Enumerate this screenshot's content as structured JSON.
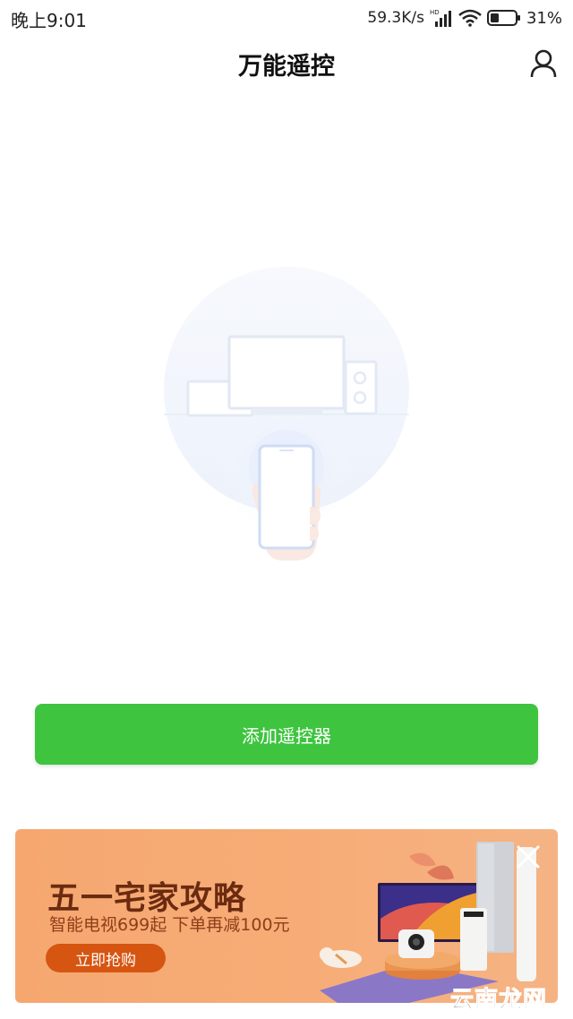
{
  "status_bar": {
    "time": "晚上9:01",
    "net_speed": "59.3K/s",
    "hd_label": "HD",
    "battery": "31%",
    "icons": [
      "signal-icon",
      "wifi-icon",
      "battery-icon"
    ]
  },
  "header": {
    "title": "万能遥控",
    "user_icon": "user-icon"
  },
  "main": {
    "add_button_label": "添加遥控器",
    "accent_color": "#3ec43f"
  },
  "ad": {
    "title": "五一宅家攻略",
    "subtitle": "智能电视699起 下单再减100元",
    "cta_label": "立即抢购",
    "close_icon": "close-icon"
  },
  "watermark": {
    "text": "云南龙网"
  }
}
